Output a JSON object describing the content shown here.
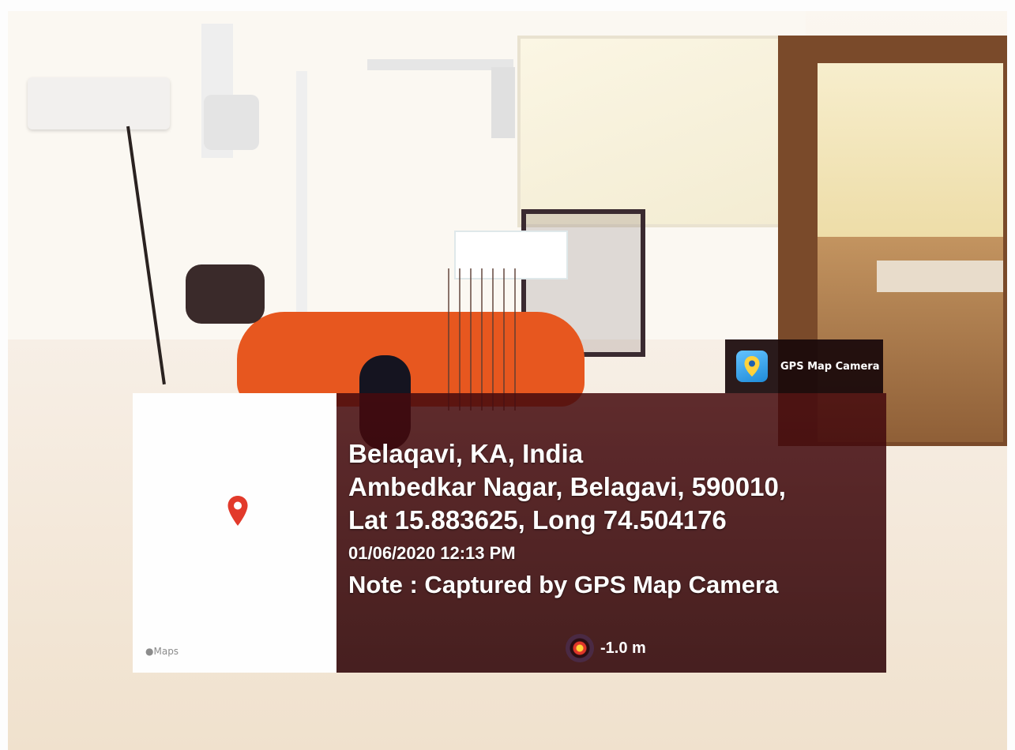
{
  "app_badge": {
    "icon": "map-pin-icon",
    "label": "GPS Map Camera"
  },
  "map_thumbnail": {
    "pin_icon": "location-pin-icon",
    "pin_color": "#e23a2b",
    "credit": "Maps"
  },
  "location": {
    "city_line": "Belaqavi, KA, India",
    "address_line": "Ambedkar Nagar, Belagavi, 590010,",
    "coords_line": "Lat 15.883625, Long 74.504176",
    "datetime": "01/06/2020 12:13 PM",
    "note": "Note : Captured by GPS Map Camera"
  },
  "altitude": {
    "icon": "altimeter-icon",
    "value": "-1.0 m"
  }
}
